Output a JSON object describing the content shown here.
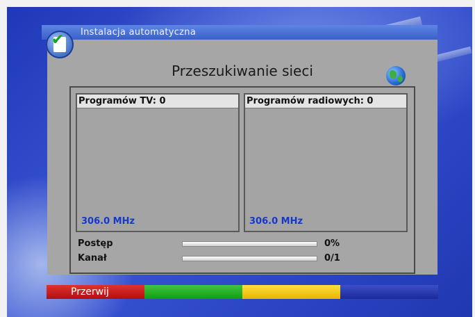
{
  "header": {
    "title": "Instalacja automatyczna",
    "icon": "checklist-icon"
  },
  "main": {
    "title": "Przeszukiwanie sieci",
    "globe_icon": "globe-icon"
  },
  "tv": {
    "header": "Programów TV: 0",
    "frequency": "306.0 MHz"
  },
  "radio": {
    "header": "Programów radiowych: 0",
    "frequency": "306.0 MHz"
  },
  "progress": {
    "label": "Postęp",
    "value_text": "0%",
    "fraction": 0
  },
  "channel": {
    "label": "Kanał",
    "value_text": "0/1",
    "fraction": 0
  },
  "buttons": {
    "red_label": "Przerwij",
    "colors": {
      "red": "#c81e1e",
      "green": "#22b022",
      "yellow": "#f5c800",
      "blue": "#2a3aa8"
    }
  }
}
